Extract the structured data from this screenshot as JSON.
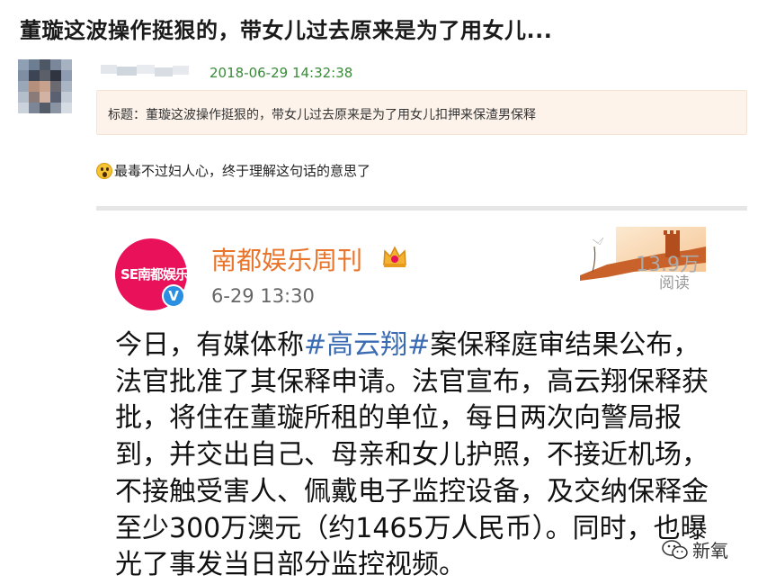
{
  "page": {
    "title": "董璇这波操作挺狠的，带女儿过去原来是为了用女儿..."
  },
  "post": {
    "timestamp": "2018-06-29 14:32:38",
    "title_box": "标题：董璇这波操作挺狠的，带女儿过去原来是为了用女儿扣押来保渣男保释",
    "comment": "最毒不过妇人心，终于理解这句话的意思了",
    "emoji": "surprised-face-icon"
  },
  "weibo": {
    "logo_text": "SE南都娱乐",
    "account_name": "南都娱乐周刊",
    "time": "6-29 13:30",
    "views_count": "13.9万",
    "views_label": "阅读",
    "body": {
      "line1_pre": "今日，有媒体称",
      "hashtag": "#高云翔#",
      "line1_post": "案保释庭审结果公布，",
      "line2": "法官批准了其保释申请。法官宣布，高云翔保释获",
      "line3": "批，将住在董璇所租的单位，每日两次向警局报",
      "line4": "到，并交出自己、母亲和女儿护照，不接近机场，",
      "line5": "不接触受害人、佩戴电子监控设备，及交纳保释金",
      "line6": "至少300万澳元（约1465万人民币）。同时，也曝",
      "line7": "光了事发当日部分监控视频。"
    },
    "verified_mark": "V"
  },
  "watermark": {
    "text": "新氧"
  },
  "colors": {
    "timestamp": "#3a8a3a",
    "account_name": "#e9742b",
    "hashtag": "#3b6cb3",
    "logo": "#e8115a",
    "title_box_bg": "#fdf3ea"
  }
}
